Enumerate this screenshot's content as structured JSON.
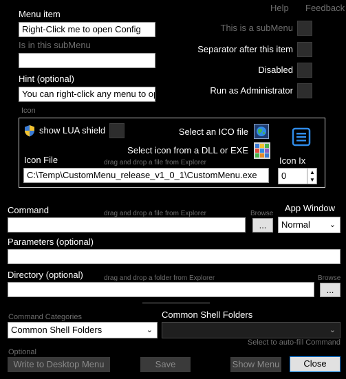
{
  "top_links": {
    "help": "Help",
    "feedback": "Feedback"
  },
  "menu_item": {
    "label": "Menu item",
    "value": "Right-Click me to open Config"
  },
  "submenu": {
    "label": "Is in this subMenu",
    "value": ""
  },
  "hint": {
    "label": "Hint (optional)",
    "value": "You can right-click any menu to op"
  },
  "options": {
    "is_submenu": "This is a subMenu",
    "separator": "Separator after this item",
    "disabled": "Disabled",
    "run_admin": "Run as Administrator"
  },
  "icon_group": {
    "title": "Icon",
    "show_lua": "show LUA shield",
    "select_ico": "Select an ICO file",
    "select_dll": "Select icon from a DLL or EXE",
    "icon_file_label": "Icon File",
    "icon_file_hint": "drag and drop a file from Explorer",
    "icon_file_value": "C:\\Temp\\CustomMenu_release_v1_0_1\\CustomMenu.exe",
    "icon_ix_label": "Icon Ix",
    "icon_ix_value": "0",
    "preview_icon": "menu-icon"
  },
  "command": {
    "label": "Command",
    "hint": "drag and drop a file from Explorer",
    "browse_label": "Browse",
    "browse_button": "...",
    "value": ""
  },
  "app_window": {
    "label": "App Window",
    "value": "Normal"
  },
  "parameters": {
    "label": "Parameters (optional)",
    "value": ""
  },
  "directory": {
    "label": "Directory (optional)",
    "hint": "drag and drop a folder from Explorer",
    "browse_label": "Browse",
    "browse_button": "...",
    "value": ""
  },
  "command_categories": {
    "label": "Command Categories",
    "value": "Common Shell Folders"
  },
  "shell_folders": {
    "label": "Common Shell Folders",
    "value": "",
    "hint": "Select to auto-fill Command"
  },
  "footer": {
    "optional_label": "Optional",
    "write_desktop": "Write to Desktop Menu",
    "save": "Save",
    "show_menu": "Show Menu",
    "close": "Close"
  },
  "colors": {
    "background": "#000000",
    "accent": "#0078d7",
    "disabled_text": "#6e6e6e"
  }
}
